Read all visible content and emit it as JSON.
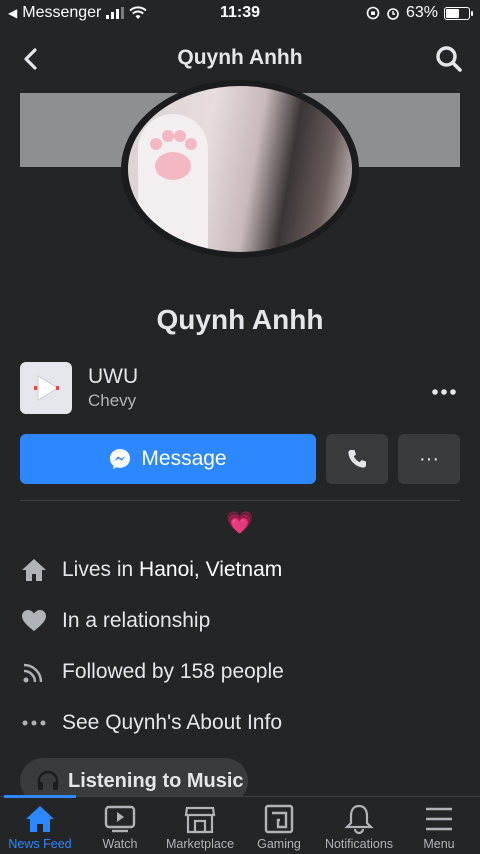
{
  "status_bar": {
    "back_app": "Messenger",
    "time": "11:39",
    "battery": "63%",
    "battery_level": 0.63
  },
  "header": {
    "title": "Quynh Anhh"
  },
  "profile": {
    "name": "Quynh Anhh",
    "bio_emoji": "💗"
  },
  "music": {
    "song": "UWU",
    "artist": "Chevy"
  },
  "actions": {
    "message_label": "Message",
    "more_label": "···"
  },
  "info": [
    {
      "prefix": "Lives in ",
      "highlight": "Hanoi, Vietnam"
    },
    {
      "text": "In a relationship"
    },
    {
      "text": "Followed by 158 people"
    },
    {
      "text": "See Quynh's About Info"
    }
  ],
  "activity": {
    "label": "Listening to Music"
  },
  "tabs": [
    {
      "label": "News Feed",
      "icon": "home-icon",
      "active": true
    },
    {
      "label": "Watch",
      "icon": "watch-icon"
    },
    {
      "label": "Marketplace",
      "icon": "marketplace-icon"
    },
    {
      "label": "Gaming",
      "icon": "gaming-icon"
    },
    {
      "label": "Notifications",
      "icon": "bell-icon"
    },
    {
      "label": "Menu",
      "icon": "menu-icon"
    }
  ],
  "colors": {
    "accent": "#2d88ff",
    "background": "#242526",
    "button": "#3a3b3c"
  }
}
